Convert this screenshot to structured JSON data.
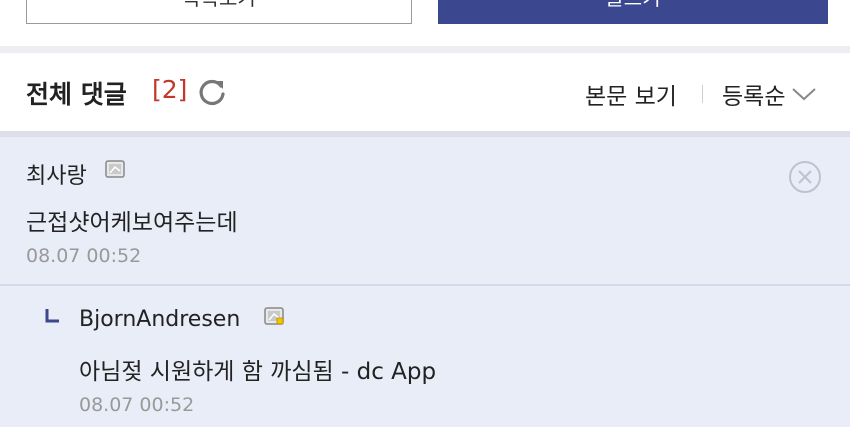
{
  "top_buttons": {
    "left_label": "목록보기",
    "right_label": "글쓰기"
  },
  "header": {
    "title": "전체 댓글",
    "count": "[2]",
    "view_link": "본문 보기",
    "sort_label": "등록순"
  },
  "comments": [
    {
      "author": "최사랑",
      "body": "근접샷어케보여주는데",
      "time": "08.07 00:52"
    },
    {
      "author": "BjornAndresen",
      "body": "아님젖 시원하게 함 까심됨 - dc App",
      "time": "08.07 00:52"
    }
  ],
  "colors": {
    "accent_button": "#3b4890",
    "count_red": "#c0392b",
    "comment_bg": "#e9edf8",
    "reply_icon": "#3b4890"
  },
  "icons": {
    "refresh": "refresh-icon",
    "chevron": "chevron-down-icon",
    "close": "close-circle-icon",
    "reply": "reply-arrow-icon",
    "badge": "user-badge-icon"
  }
}
